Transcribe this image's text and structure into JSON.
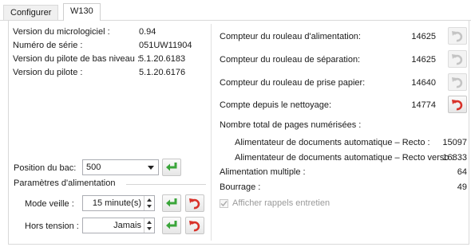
{
  "tabs": [
    {
      "label": "Configurer"
    },
    {
      "label": "W130"
    }
  ],
  "device_info": [
    {
      "label": "Version du micrologiciel :",
      "value": "0.94"
    },
    {
      "label": "Numéro de série :",
      "value": "051UW11904"
    },
    {
      "label": "Version du pilote de bas niveau :",
      "value": "5.1.20.6183"
    },
    {
      "label": "Version du pilote :",
      "value": "5.1.20.6176"
    }
  ],
  "tray": {
    "label": "Position du bac:",
    "value": "500"
  },
  "power": {
    "group_label": "Paramètres d'alimentation",
    "sleep_label": "Mode veille :",
    "sleep_value": "15 minute(s)",
    "off_label": "Hors tension :",
    "off_value": "Jamais"
  },
  "counters": [
    {
      "label": "Compteur du rouleau d'alimentation:",
      "value": "14625"
    },
    {
      "label": "Compteur du rouleau de séparation:",
      "value": "14625"
    },
    {
      "label": "Compteur du rouleau de prise papier:",
      "value": "14640"
    },
    {
      "label": "Compte depuis le nettoyage:",
      "value": "14774"
    }
  ],
  "totals": {
    "heading": "Nombre total de pages numérisées :",
    "recto_label": "Alimentateur de documents automatique – Recto :",
    "recto_value": "15097",
    "rv_label": "Alimentateur de documents automatique – Recto verso :",
    "rv_value": "16833",
    "multi_label": "Alimentation multiple :",
    "multi_value": "64",
    "jam_label": "Bourrage :",
    "jam_value": "49"
  },
  "reminder": {
    "label": "Afficher rappels entretien",
    "checked": true
  },
  "icons": {
    "apply": "green-check-arrow-icon",
    "reset": "red-undo-icon",
    "reset_disabled": "grey-undo-icon"
  },
  "colors": {
    "apply": "#3aa53a",
    "reset": "#d8322a",
    "disabled": "#c4c4c4"
  }
}
